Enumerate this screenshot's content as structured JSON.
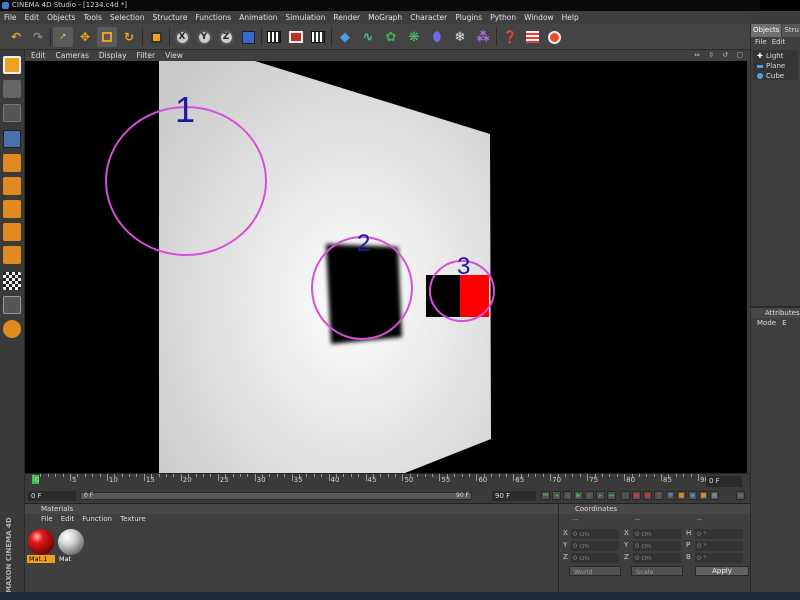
{
  "window": {
    "title": "CINEMA 4D Studio - [1234.c4d *]"
  },
  "menubar": [
    "File",
    "Edit",
    "Objects",
    "Tools",
    "Selection",
    "Structure",
    "Functions",
    "Animation",
    "Simulation",
    "Render",
    "MoGraph",
    "Character",
    "Plugins",
    "Python",
    "Window",
    "Help"
  ],
  "toolbar": {
    "axis_x": "X",
    "axis_y": "Y",
    "axis_z": "Z"
  },
  "viewport": {
    "menu": [
      "Edit",
      "Cameras",
      "Display",
      "Filter",
      "View"
    ],
    "nav_icons": "⇔ ⇳ ↺ ▢",
    "annotations": [
      "1",
      "2",
      "3"
    ],
    "colors": {
      "circle": "#d84ed8",
      "number": "#1a1a9e",
      "plane": "#e0e0e0",
      "cube_red": "#ff0000"
    }
  },
  "objects_panel": {
    "tabs": [
      "Objects",
      "Stru"
    ],
    "menu": [
      "File",
      "Edit"
    ],
    "items": [
      {
        "name": "Light",
        "icon": "light-icon"
      },
      {
        "name": "Plane",
        "icon": "plane-icon"
      },
      {
        "name": "Cube",
        "icon": "cube-icon"
      }
    ]
  },
  "attributes_panel": {
    "title": "Attributes",
    "menu": [
      "Mode",
      "E"
    ]
  },
  "timeline": {
    "ticks": [
      "0",
      "5",
      "10",
      "15",
      "20",
      "25",
      "30",
      "35",
      "40",
      "45",
      "50",
      "55",
      "60",
      "65",
      "70",
      "75",
      "80",
      "85",
      "90"
    ],
    "current_frame": "0 F",
    "start_field": "0 F",
    "slider_start": "0 F",
    "slider_end": "90 F",
    "end_field": "90 F"
  },
  "materials": {
    "title": "Materials",
    "menu": [
      "File",
      "Edit",
      "Function",
      "Texture"
    ],
    "items": [
      {
        "label": "Mat.1",
        "color": "#d01010",
        "selected": true
      },
      {
        "label": "Mat",
        "color": "#e8e8e8",
        "selected": false
      }
    ]
  },
  "coordinates": {
    "title": "Coordinates",
    "col_heads": [
      "--",
      "--",
      "--"
    ],
    "rows": [
      {
        "a": "X",
        "av": "0 cm",
        "b": "X",
        "bv": "0 cm",
        "c": "H",
        "cv": "0 °"
      },
      {
        "a": "Y",
        "av": "0 cm",
        "b": "Y",
        "bv": "0 cm",
        "c": "P",
        "cv": "0 °"
      },
      {
        "a": "Z",
        "av": "0 cm",
        "b": "Z",
        "bv": "0 cm",
        "c": "B",
        "cv": "0 °"
      }
    ],
    "space": "World",
    "mode": "Scale",
    "apply": "Apply"
  },
  "branding": "MAXON CINEMA 4D"
}
